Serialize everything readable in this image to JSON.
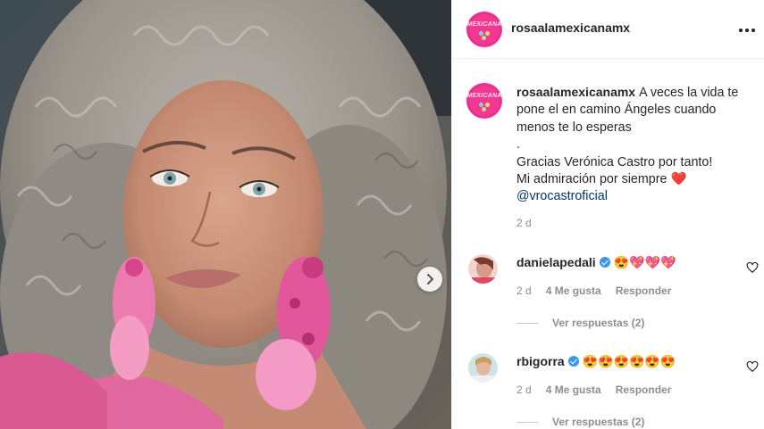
{
  "post": {
    "account": "rosaalamexicanamx",
    "avatar_word": "MEXICANA",
    "caption_lines": [
      "A veces la vida te pone el en camino Ángeles cuando menos te lo esperas",
      ".",
      "Gracias Verónica Castro por tanto!",
      "Mi admiración por siempre"
    ],
    "heart_emoji": "❤️",
    "mention": "@vrocastroficial",
    "time": "2 d"
  },
  "comments": [
    {
      "username": "danielapedali",
      "verified": true,
      "text": "😍💖💖💖",
      "time": "2 d",
      "likes": "4 Me gusta",
      "reply": "Responder",
      "view_replies": "Ver respuestas (2)"
    },
    {
      "username": "rbigorra",
      "verified": true,
      "text": "😍😍😍😍😍😍",
      "time": "2 d",
      "likes": "4 Me gusta",
      "reply": "Responder",
      "view_replies": "Ver respuestas (2)"
    }
  ],
  "colors": {
    "brand_pink": "#ec2f8f",
    "verified_blue": "#3897f0",
    "mention_blue": "#00376b",
    "muted_text": "#8e8e8e"
  },
  "icons": [
    "chevron-right-icon",
    "more-options-icon",
    "verified-badge-icon",
    "heart-outline-icon"
  ]
}
